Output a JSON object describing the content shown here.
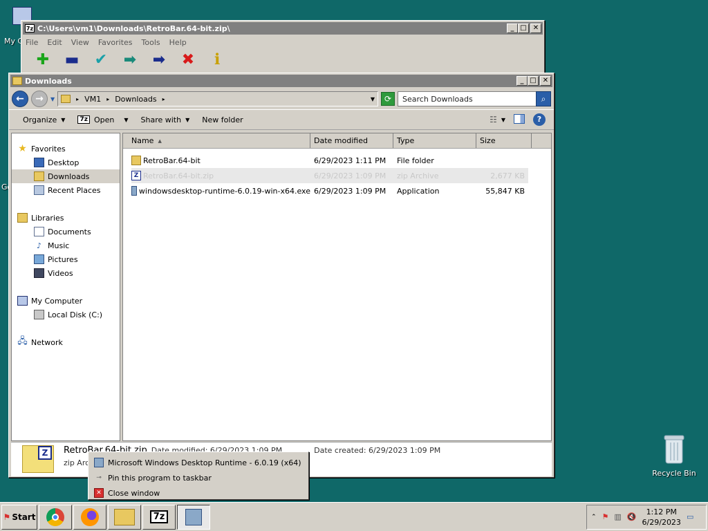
{
  "desktop": {
    "icons": [
      {
        "label": "My C"
      },
      {
        "label": "Go"
      },
      {
        "label": "Recycle Bin"
      }
    ]
  },
  "sevenzip": {
    "title": "C:\\Users\\vm1\\Downloads\\RetroBar.64-bit.zip\\",
    "icon_text": "7z",
    "menu": [
      "File",
      "Edit",
      "View",
      "Favorites",
      "Tools",
      "Help"
    ],
    "tools": [
      {
        "icon": "add-icon",
        "glyph": "✚",
        "color": "#1aa51a"
      },
      {
        "icon": "extract-icon",
        "glyph": "▬",
        "color": "#1a2c8c"
      },
      {
        "icon": "test-icon",
        "glyph": "✔",
        "color": "#1aa0a8"
      },
      {
        "icon": "copy-icon",
        "glyph": "➡",
        "color": "#1a8a7a"
      },
      {
        "icon": "move-icon",
        "glyph": "➡",
        "color": "#1a2c8c"
      },
      {
        "icon": "delete-icon",
        "glyph": "✖",
        "color": "#d81a1a"
      },
      {
        "icon": "info-icon",
        "glyph": "ℹ",
        "color": "#c8a000"
      }
    ]
  },
  "explorer": {
    "title": "Downloads",
    "address": {
      "crumbs": [
        "VM1",
        "Downloads"
      ]
    },
    "search": {
      "placeholder": "Search Downloads"
    },
    "commands": {
      "organize": "Organize",
      "open": "Open",
      "share": "Share with",
      "new_folder": "New folder"
    },
    "nav": {
      "favorites": "Favorites",
      "desktop": "Desktop",
      "downloads": "Downloads",
      "recent": "Recent Places",
      "libraries": "Libraries",
      "documents": "Documents",
      "music": "Music",
      "pictures": "Pictures",
      "videos": "Videos",
      "computer": "My Computer",
      "local_disk": "Local Disk (C:)",
      "network": "Network"
    },
    "columns": {
      "name": "Name",
      "date": "Date modified",
      "type": "Type",
      "size": "Size"
    },
    "files": [
      {
        "name": "RetroBar.64-bit",
        "date": "6/29/2023 1:11 PM",
        "type": "File folder",
        "size": ""
      },
      {
        "name": "RetroBar.64-bit.zip",
        "date": "6/29/2023 1:09 PM",
        "type": "zip Archive",
        "size": "2,677 KB"
      },
      {
        "name": "windowsdesktop-runtime-6.0.19-win-x64.exe",
        "date": "6/29/2023 1:09 PM",
        "type": "Application",
        "size": "55,847 KB"
      }
    ],
    "details": {
      "name": "RetroBar.64-bit.zip",
      "modified": "Date modified: 6/29/2023 1:09 PM",
      "created": "Date created: 6/29/2023 1:09 PM",
      "type": "zip Archive"
    }
  },
  "jumplist": {
    "items": [
      "Microsoft Windows Desktop Runtime - 6.0.19 (x64)",
      "Pin this program to taskbar",
      "Close window"
    ]
  },
  "taskbar": {
    "start": "Start",
    "clock_time": "1:12 PM",
    "clock_date": "6/29/2023",
    "sevenzip_label": "7z"
  }
}
